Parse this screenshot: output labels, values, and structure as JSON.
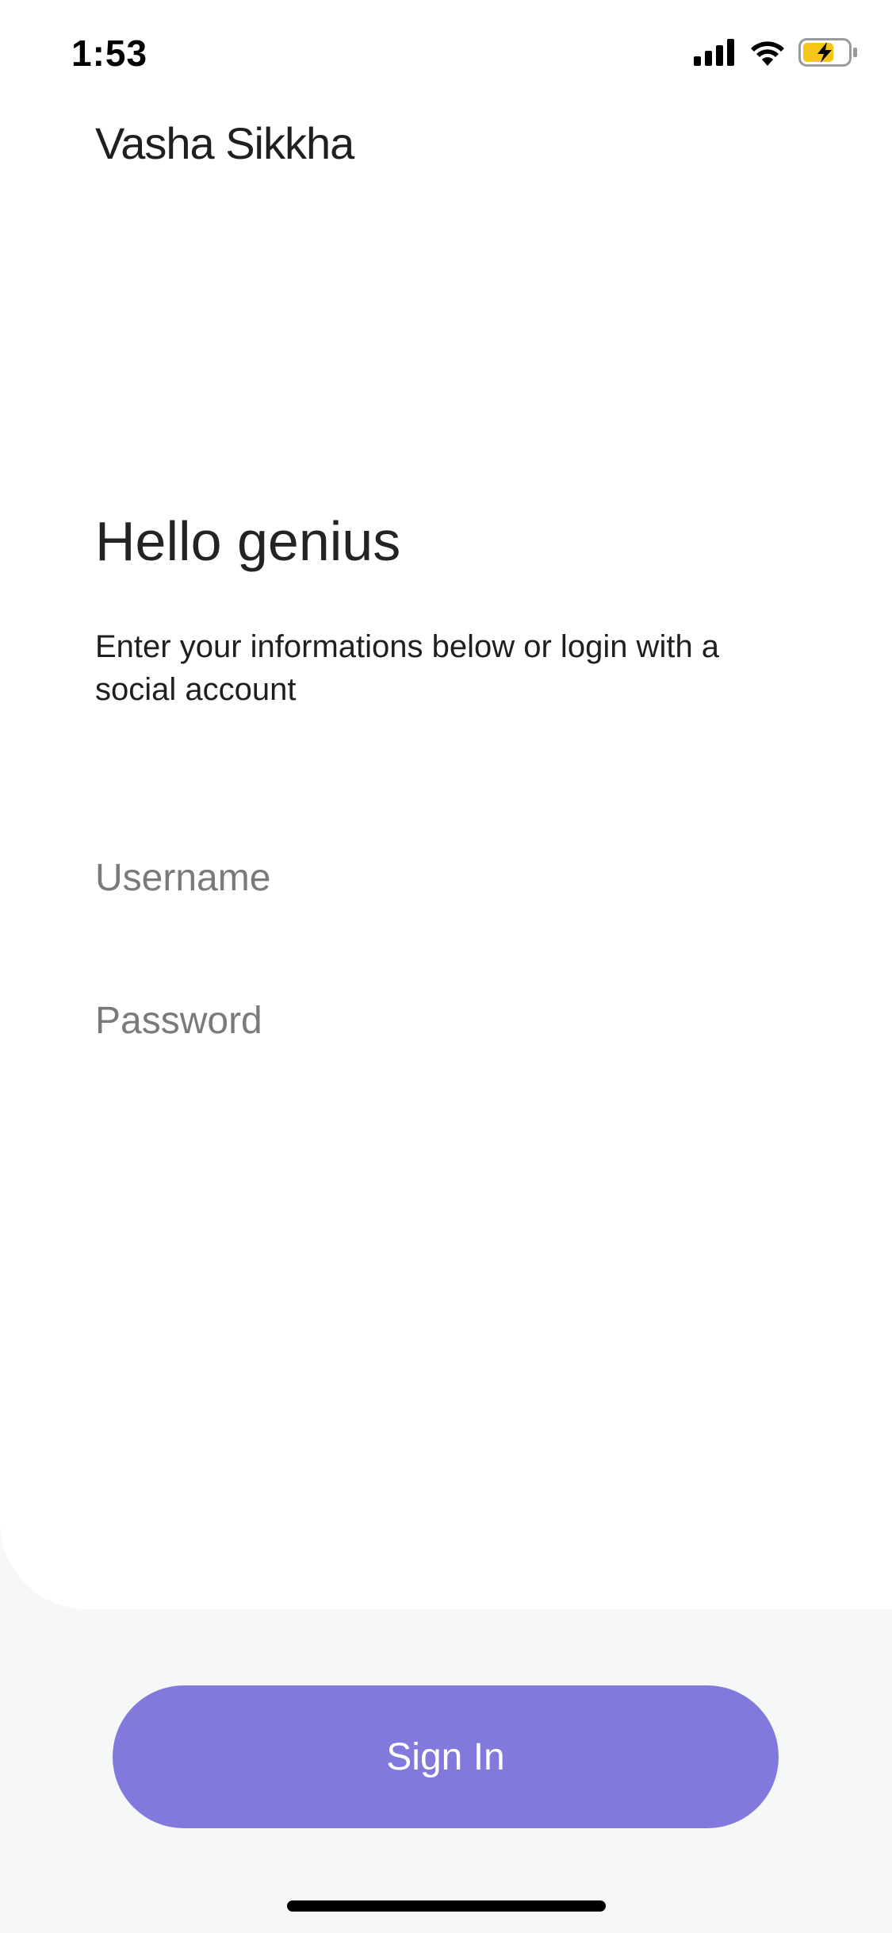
{
  "status_bar": {
    "time": "1:53",
    "icons": [
      "signal-icon",
      "wifi-icon",
      "battery-charging-icon"
    ]
  },
  "app": {
    "brand": "Vasha Sikkha"
  },
  "login": {
    "title": "Hello genius",
    "subtitle": "Enter your informations below or login with a social account",
    "username_placeholder": "Username",
    "username_value": "",
    "password_placeholder": "Password",
    "password_value": "",
    "signin_label": "Sign In"
  },
  "colors": {
    "accent": "#8279dc",
    "background": "#f6f7f7",
    "card": "#ffffff",
    "battery_fill": "#f5c518"
  }
}
